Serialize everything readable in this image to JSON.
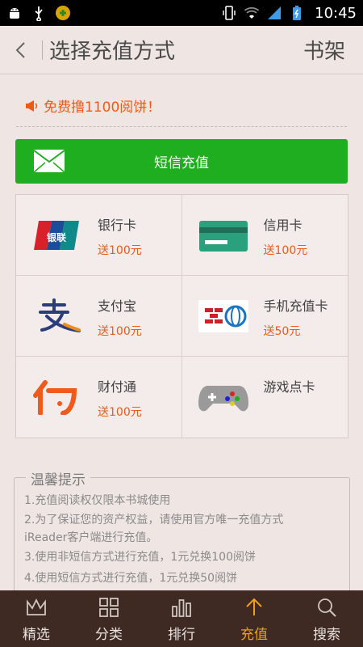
{
  "status_bar": {
    "time": "10:45"
  },
  "header": {
    "title": "选择充值方式",
    "shelf_label": "书架"
  },
  "promo": {
    "text": "免费撸1100阅饼！"
  },
  "sms_button": {
    "label": "短信充值"
  },
  "payment_methods": [
    {
      "name": "银行卡",
      "bonus": "送100元",
      "icon": "unionpay-icon"
    },
    {
      "name": "信用卡",
      "bonus": "送100元",
      "icon": "credit-card-icon"
    },
    {
      "name": "支付宝",
      "bonus": "送100元",
      "icon": "alipay-icon"
    },
    {
      "name": "手机充值卡",
      "bonus": "送50元",
      "icon": "mobile-card-icon"
    },
    {
      "name": "财付通",
      "bonus": "送100元",
      "icon": "tenpay-icon"
    },
    {
      "name": "游戏点卡",
      "bonus": "",
      "icon": "gamepad-icon"
    }
  ],
  "tips": {
    "title": "温馨提示",
    "lines": [
      "1.充值阅读权仅限本书城使用",
      "2.为了保证您的资产权益，请使用官方唯一充值方式",
      "iReader客户端进行充值。",
      "3.使用非短信方式进行充值，1元兑换100阅饼",
      "4.使用短信方式进行充值，1元兑换50阅饼"
    ]
  },
  "bottom_nav": [
    {
      "label": "精选",
      "icon": "crown-icon"
    },
    {
      "label": "分类",
      "icon": "grid-icon"
    },
    {
      "label": "排行",
      "icon": "bar-chart-icon"
    },
    {
      "label": "充值",
      "icon": "recharge-icon"
    },
    {
      "label": "搜索",
      "icon": "search-icon"
    }
  ],
  "colors": {
    "accent_green": "#1fae1f",
    "accent_orange": "#ef5a17",
    "nav_bg": "#3e2a23",
    "page_bg": "#efe6e3"
  }
}
